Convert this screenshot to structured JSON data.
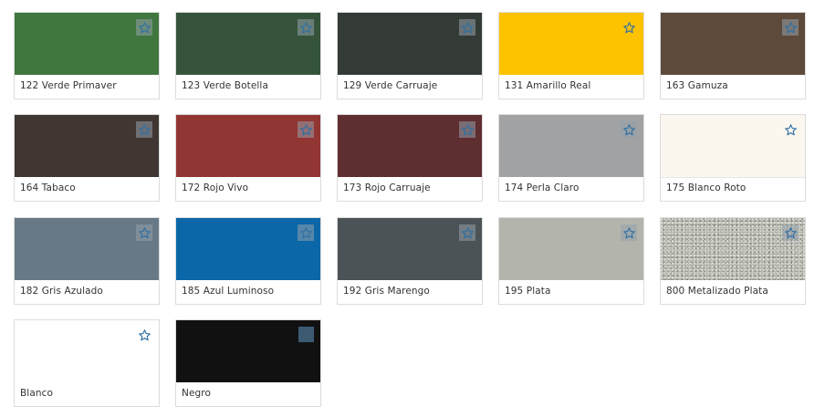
{
  "colors": [
    {
      "label": "122 Verde Primaver",
      "hex": "#3f773e",
      "fav_icon": "star-icon"
    },
    {
      "label": "123 Verde Botella",
      "hex": "#36543c",
      "fav_icon": "star-icon"
    },
    {
      "label": "129 Verde Carruaje",
      "hex": "#343b37",
      "fav_icon": "star-icon"
    },
    {
      "label": "131 Amarillo Real",
      "hex": "#fec300",
      "fav_icon": "star-icon"
    },
    {
      "label": "163 Gamuza",
      "hex": "#5e4a3b",
      "fav_icon": "star-icon"
    },
    {
      "label": "164 Tabaco",
      "hex": "#403733",
      "fav_icon": "star-icon"
    },
    {
      "label": "172 Rojo Vivo",
      "hex": "#923634",
      "fav_icon": "star-icon"
    },
    {
      "label": "173 Rojo Carruaje",
      "hex": "#5e2e31",
      "fav_icon": "star-icon"
    },
    {
      "label": "174 Perla Claro",
      "hex": "#a0a2a3",
      "fav_icon": "star-icon"
    },
    {
      "label": "175 Blanco Roto",
      "hex": "#fbf7ef",
      "fav_icon": "star-icon"
    },
    {
      "label": "182 Gris Azulado",
      "hex": "#677986",
      "fav_icon": "star-icon"
    },
    {
      "label": "185 Azul Luminoso",
      "hex": "#0b67a8",
      "fav_icon": "star-icon"
    },
    {
      "label": "192 Gris Marengo",
      "hex": "#4b5356",
      "fav_icon": "star-icon"
    },
    {
      "label": "195 Plata",
      "hex": "#b3b5ad",
      "fav_icon": "star-icon"
    },
    {
      "label": "800 Metalizado Plata",
      "hex": "#b3b5ab",
      "fav_icon": "star-icon"
    },
    {
      "label": "Blanco",
      "hex": "#ffffff",
      "fav_icon": "star-icon"
    },
    {
      "label": "Negro",
      "hex": "#111111",
      "fav_icon": "square-icon"
    }
  ],
  "accent": "#2f6fa3"
}
